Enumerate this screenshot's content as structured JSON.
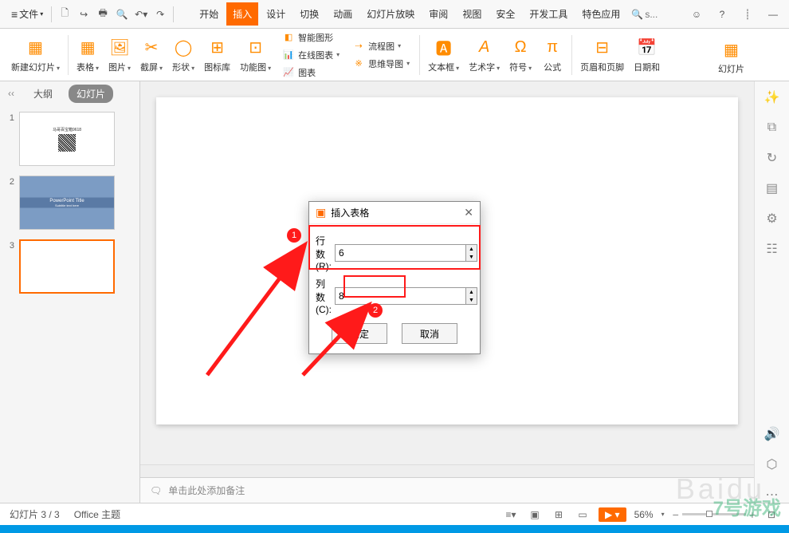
{
  "menubar": {
    "file_label": "文件",
    "tabs": [
      "开始",
      "插入",
      "设计",
      "切换",
      "动画",
      "幻灯片放映",
      "审阅",
      "视图",
      "安全",
      "开发工具",
      "特色应用"
    ],
    "active_tab": "插入",
    "search_prefix": "Q",
    "search_placeholder": "s..."
  },
  "ribbon": {
    "new_slide": "新建幻灯片",
    "table": "表格",
    "picture": "图片",
    "screenshot": "截屏",
    "shapes": "形状",
    "icon_lib": "图标库",
    "function_chart": "功能图",
    "stack1": {
      "smart": "智能图形",
      "online": "在线图表",
      "chart": "图表"
    },
    "stack2": {
      "flow": "流程图",
      "mind": "思维导图"
    },
    "textbox": "文本框",
    "wordart": "艺术字",
    "symbol": "符号",
    "formula": "公式",
    "header_footer": "页眉和页脚",
    "datetime": "日期和",
    "slide_overflow": "幻灯片"
  },
  "panel": {
    "outline": "大纲",
    "slides": "幻灯片",
    "thumb2_title": "PowerPoint Title",
    "thumb2_sub": "Subtitle text here"
  },
  "dialog": {
    "title": "插入表格",
    "rows_label": "行数(R):",
    "cols_label": "列数(C):",
    "rows_value": "6",
    "cols_value": "8",
    "ok": "确定",
    "cancel": "取消"
  },
  "annotations": {
    "n1": "1",
    "n2": "2"
  },
  "notes_placeholder": "单击此处添加备注",
  "status": {
    "slide_counter": "幻灯片 3 / 3",
    "theme": "Office 主题",
    "zoom": "56%"
  },
  "watermark1": "Baidu",
  "watermark2": "7号游戏"
}
